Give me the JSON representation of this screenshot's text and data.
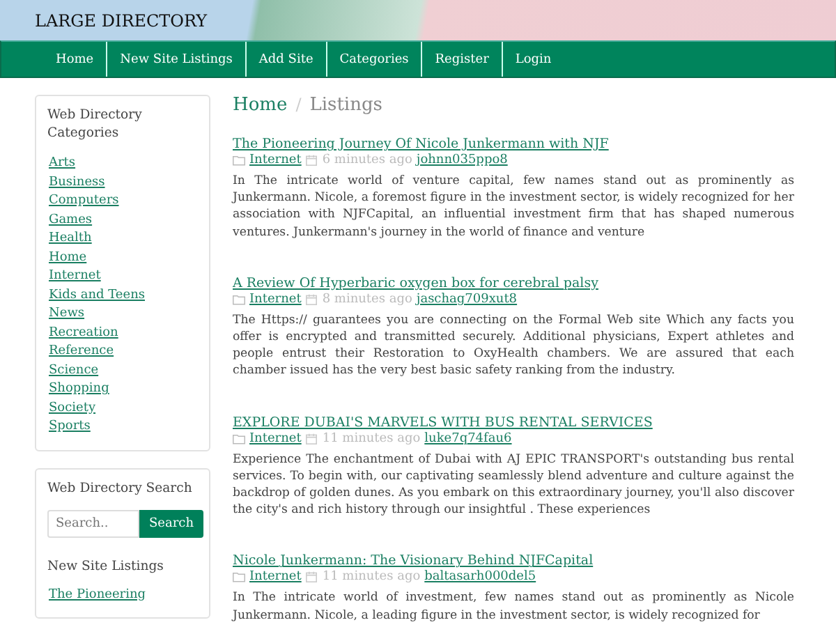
{
  "site_title": "LARGE DIRECTORY",
  "nav": [
    "Home",
    "New Site Listings",
    "Add Site",
    "Categories",
    "Register",
    "Login"
  ],
  "sidebar": {
    "categories_title": "Web Directory Categories",
    "categories": [
      "Arts",
      "Business",
      "Computers",
      "Games",
      "Health",
      "Home",
      "Internet",
      "Kids and Teens",
      "News",
      "Recreation",
      "Reference",
      "Science",
      "Shopping",
      "Society",
      "Sports"
    ],
    "search_title": "Web Directory Search",
    "search": {
      "placeholder": "Search..",
      "button": "Search"
    },
    "new_listings_title": "New Site Listings",
    "new_listings": [
      "The Pioneering"
    ]
  },
  "breadcrumb": [
    "Home",
    "Listings"
  ],
  "breadcrumb_separator": "/",
  "listings": [
    {
      "title": "The Pioneering Journey Of Nicole Junkermann with NJF",
      "category": "Internet",
      "time": "6 minutes ago",
      "user": "johnn035ppo8",
      "description": "In The intricate world of venture capital, few names stand out as prominently as Junkermann. Nicole, a foremost figure in the investment sector, is widely recognized for her association with NJFCapital, an influential investment firm that has shaped numerous ventures. Junkermann's journey in the world of finance and venture"
    },
    {
      "title": "A Review Of Hyperbaric oxygen box for cerebral palsy",
      "category": "Internet",
      "time": "8 minutes ago",
      "user": "jaschag709xut8",
      "description": "The Https:// guarantees you are connecting on the Formal Web site Which any facts you offer is encrypted and transmitted securely. Additional physicians, Expert athletes and people entrust their Restoration to OxyHealth chambers. We are assured that each chamber issued has the very best basic safety ranking from the industry."
    },
    {
      "title": "EXPLORE DUBAI'S MARVELS WITH BUS RENTAL SERVICES",
      "category": "Internet",
      "time": "11 minutes ago",
      "user": "luke7q74fau6",
      "description": "Experience The enchantment of Dubai with AJ EPIC TRANSPORT's outstanding bus rental services. To begin with, our captivating seamlessly blend adventure and culture against the backdrop of golden dunes. As you embark on this extraordinary journey, you'll also discover the city's and rich history through our insightful . These experiences"
    },
    {
      "title": "Nicole Junkermann: The Visionary Behind NJFCapital",
      "category": "Internet",
      "time": "11 minutes ago",
      "user": "baltasarh000del5",
      "description": "In The intricate world of investment, few names stand out as prominently as Nicole Junkermann. Nicole, a leading figure in the investment sector, is widely recognized for"
    }
  ]
}
